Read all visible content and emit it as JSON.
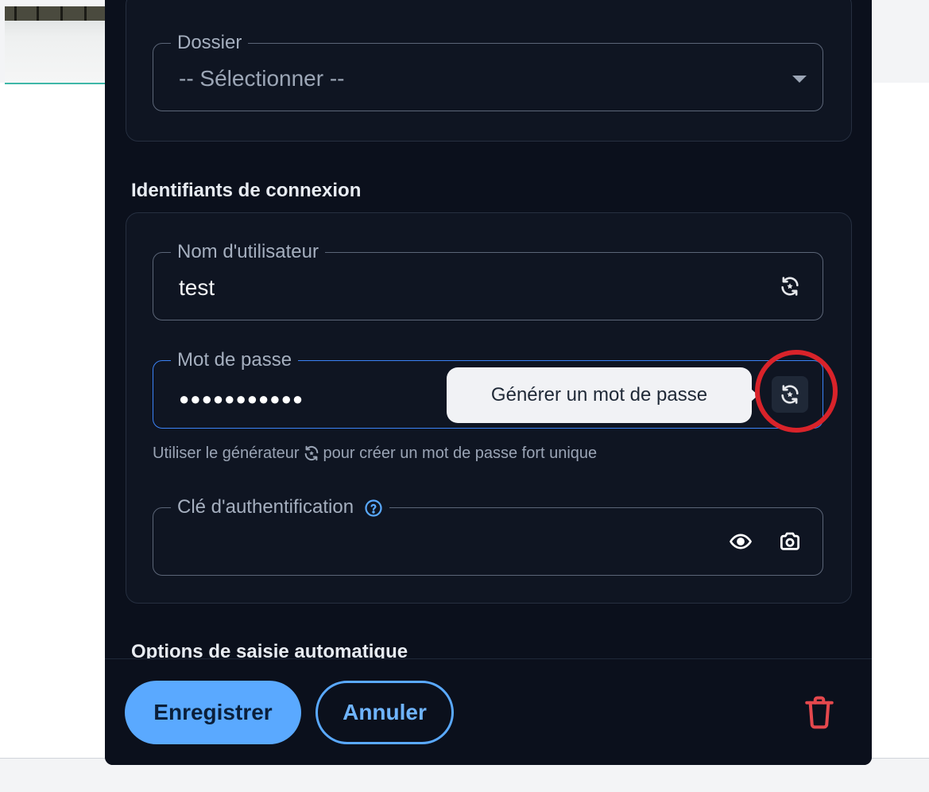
{
  "form": {
    "folder": {
      "label": "Dossier",
      "placeholder": "-- Sélectionner --"
    },
    "credentials_title": "Identifiants de connexion",
    "username": {
      "label": "Nom d'utilisateur",
      "value": "test"
    },
    "password": {
      "label": "Mot de passe",
      "value": "●●●●●●●●●●●"
    },
    "password_hint_before": "Utiliser le générateur",
    "password_hint_after": "pour créer un mot de passe fort unique",
    "auth_key": {
      "label": "Clé d'authentification",
      "value": ""
    },
    "autofill_title": "Options de saisie automatique"
  },
  "tooltip": {
    "generate_password": "Générer un mot de passe"
  },
  "footer": {
    "save_label": "Enregistrer",
    "cancel_label": "Annuler"
  },
  "colors": {
    "panel": "#0b101c",
    "accent": "#5aa9ff",
    "focus": "#3b82f6",
    "danger": "#e5484d",
    "highlight_ring": "#d9232a"
  },
  "icons": {
    "folder_dropdown": "chevron-down-icon",
    "username_generate": "generate-icon",
    "password_generate": "generate-icon",
    "auth_key_visibility": "eye-icon",
    "auth_key_scan": "camera-icon",
    "help": "help-circle-icon",
    "delete": "trash-icon"
  }
}
